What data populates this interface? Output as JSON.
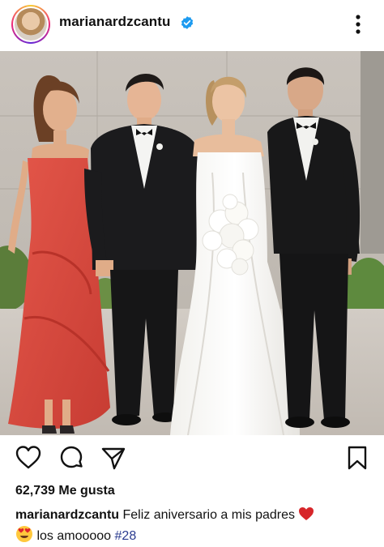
{
  "header": {
    "username": "marianardzcantu",
    "avatar_icon": "profile-avatar",
    "verified_icon": "verified-badge-icon",
    "more_icon": "more-options-icon",
    "verified_color": "#1d9bf0"
  },
  "post": {
    "image_icon": "post-photo",
    "actions": {
      "like_icon": "heart-icon",
      "comment_icon": "comment-icon",
      "share_icon": "send-icon",
      "save_icon": "bookmark-icon"
    },
    "likes_text": "62,739 Me gusta",
    "caption": {
      "user": "marianardzcantu",
      "text": "Feliz aniversario a mis padres",
      "emoji_heart": "red-heart-emoji",
      "emoji_face": "heart-eyes-emoji",
      "text2": "los amooooo",
      "hashtag": "#28",
      "hashtag_color": "#2a3b8f"
    }
  }
}
